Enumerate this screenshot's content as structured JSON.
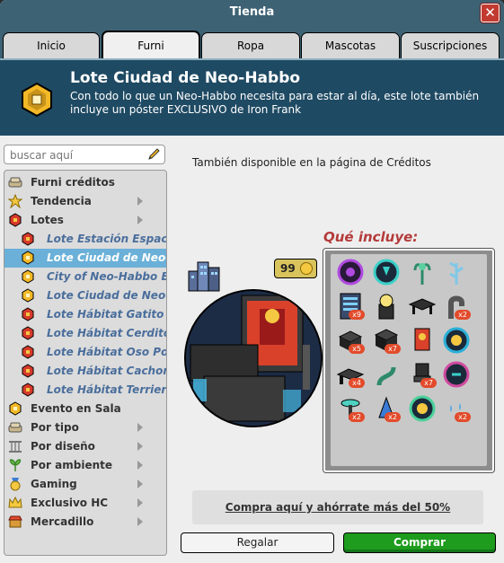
{
  "window": {
    "title": "Tienda"
  },
  "tabs": [
    {
      "label": "Inicio"
    },
    {
      "label": "Furni"
    },
    {
      "label": "Ropa"
    },
    {
      "label": "Mascotas"
    },
    {
      "label": "Suscripciones"
    }
  ],
  "banner": {
    "title": "Lote Ciudad de Neo-Habbo",
    "description": "Con todo lo que un Neo-Habbo necesita para estar al día, este lote también incluye un póster EXCLUSIVO de Iron Frank"
  },
  "search": {
    "placeholder": "buscar aquí"
  },
  "nav": {
    "items": [
      {
        "label": "Furni créditos",
        "icon": "sofa-icon"
      },
      {
        "label": "Tendencia",
        "icon": "star-icon"
      },
      {
        "label": "Lotes",
        "icon": "hexagon-icon"
      },
      {
        "label": "Lote Estación Espacial",
        "icon": "hexagon-icon"
      },
      {
        "label": "Lote Ciudad de Neo-Habbo",
        "icon": "hexagon-icon"
      },
      {
        "label": "City of Neo-Habbo Bundle",
        "icon": "hexagon-icon"
      },
      {
        "label": "Lote Ciudad de Neo-Habbo",
        "icon": "hexagon-icon"
      },
      {
        "label": "Lote Hábitat Gatito",
        "icon": "hexagon-icon"
      },
      {
        "label": "Lote Hábitat Cerdito",
        "icon": "hexagon-icon"
      },
      {
        "label": "Lote Hábitat Oso Polar",
        "icon": "hexagon-icon"
      },
      {
        "label": "Lote Hábitat Cachorro",
        "icon": "hexagon-icon"
      },
      {
        "label": "Lote Hábitat Terrier",
        "icon": "hexagon-icon"
      },
      {
        "label": "Evento en Sala",
        "icon": "hexagon-icon"
      },
      {
        "label": "Por tipo",
        "icon": "sofa-icon"
      },
      {
        "label": "Por diseño",
        "icon": "column-icon"
      },
      {
        "label": "Por ambiente",
        "icon": "plant-icon"
      },
      {
        "label": "Gaming",
        "icon": "medal-icon"
      },
      {
        "label": "Exclusivo HC",
        "icon": "crown-icon"
      },
      {
        "label": "Mercadillo",
        "icon": "shop-icon"
      }
    ]
  },
  "main": {
    "availability": "También disponible en la página de Créditos",
    "includes_title": "Qué incluye:",
    "price": "99",
    "quantities": [
      "x9",
      "x2",
      "x5",
      "x7",
      "x4",
      "x7",
      "x2",
      "x2",
      "x2"
    ],
    "deal_text": "Compra aquí y ahórrate más del 50%",
    "gift_label": "Regalar",
    "buy_label": "Comprar"
  },
  "colors": {
    "titlebar": "#3d6274",
    "banner": "#1f4a63",
    "buy_button": "#1e9c1e",
    "selected_item": "#6ab0d8",
    "includes_title": "#b53a3a"
  }
}
